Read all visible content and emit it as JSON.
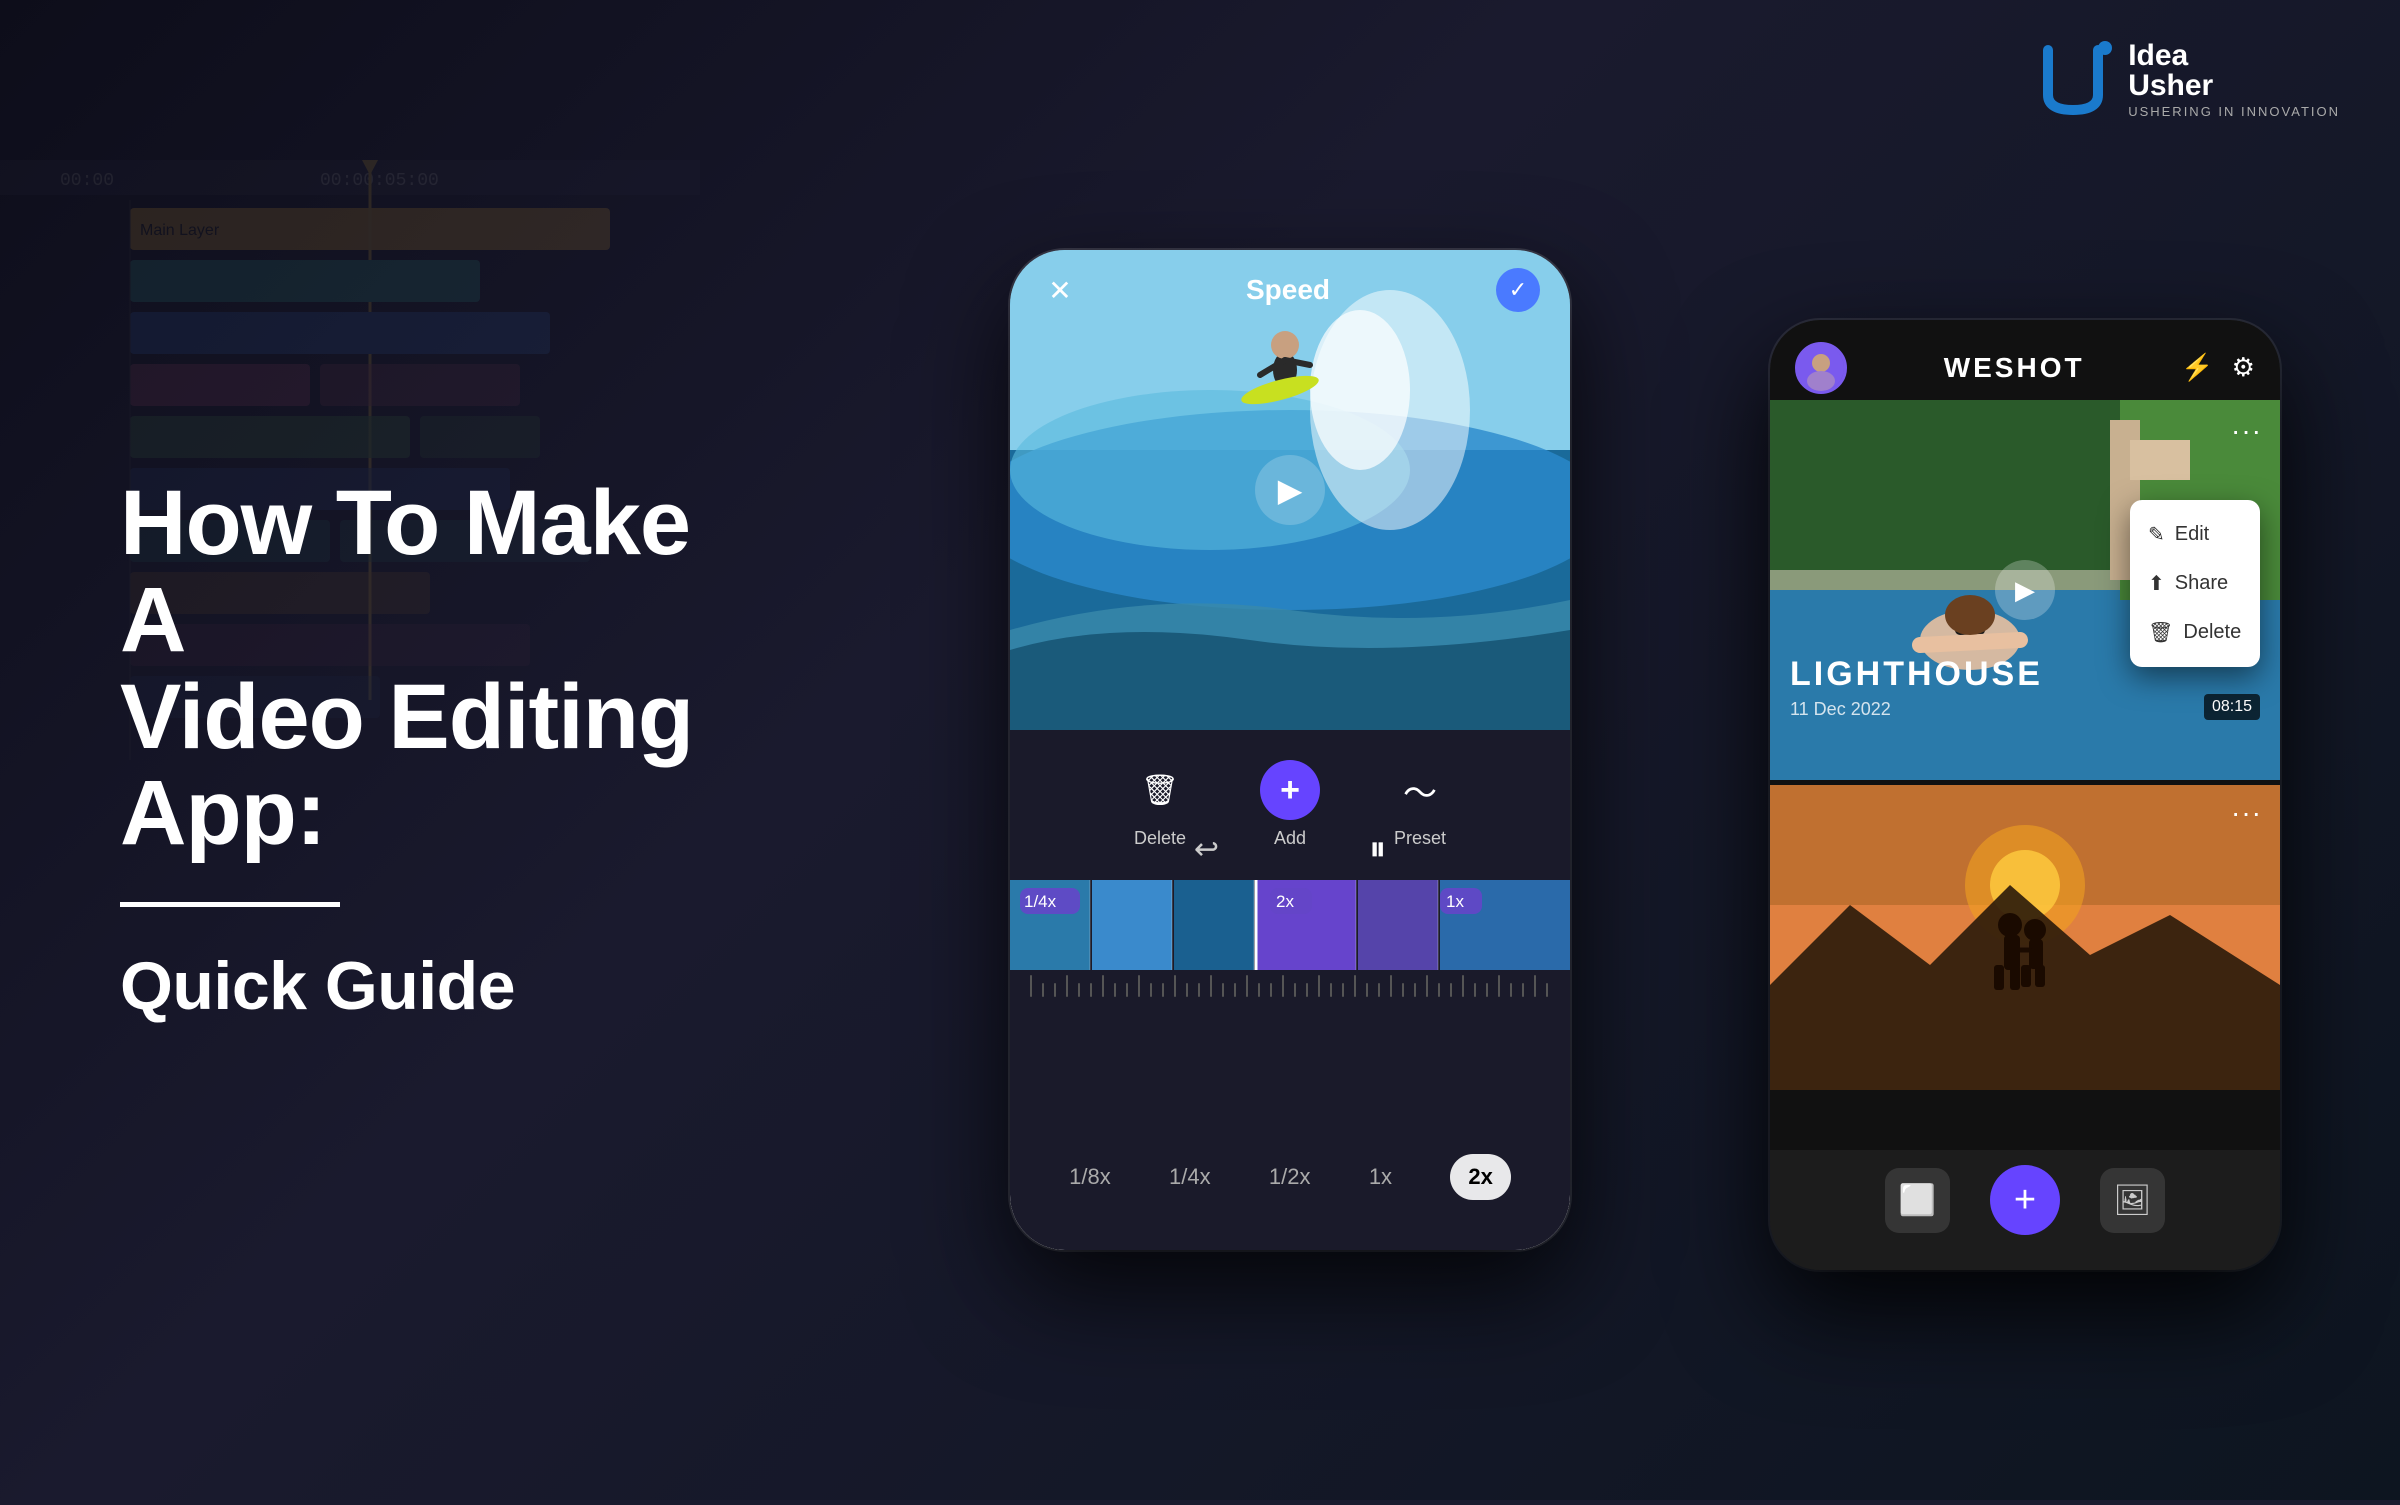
{
  "page": {
    "title": "How To Make A Video Editing App: Quick Guide",
    "background": {
      "primary": "#1a1a2e",
      "secondary": "#0d0d1a"
    }
  },
  "logo": {
    "icon_letter": "U",
    "brand_name_top": "Idea",
    "brand_name_bottom": "Usher",
    "tagline": "USHERING IN INNOVATION"
  },
  "hero": {
    "title_line1": "How To Make A",
    "title_line2": "Video Editing App:",
    "subtitle": "Quick Guide"
  },
  "phone1": {
    "screen_title": "Speed",
    "close_label": "✕",
    "check_label": "✓",
    "play_label": "▶",
    "undo_label": "↩",
    "pause_label": "⏸",
    "controls": [
      {
        "icon": "🗑",
        "label": "Delete"
      },
      {
        "icon": "+",
        "label": "Add"
      },
      {
        "icon": "〜",
        "label": "Preset"
      }
    ],
    "speed_badges": [
      "1/4x",
      "2x",
      "1x"
    ],
    "speed_options": [
      "1/8x",
      "1/4x",
      "1/2x",
      "1x",
      "2x"
    ],
    "active_speed": "2x"
  },
  "phone2": {
    "logo": "WESHOT",
    "card1": {
      "title": "LIGHTHOUSE",
      "date": "11 Dec 2022",
      "duration": "08:15"
    },
    "context_menu": {
      "items": [
        "Edit",
        "Share",
        "Delete"
      ]
    },
    "card2_label": "sunset couple",
    "bottom_buttons": [
      "⬜",
      "+",
      "🖼"
    ]
  },
  "timeline_bg": {
    "ruler_marks": [
      "00:00",
      "00:00:05:00"
    ],
    "track_label": "Main Layer"
  }
}
